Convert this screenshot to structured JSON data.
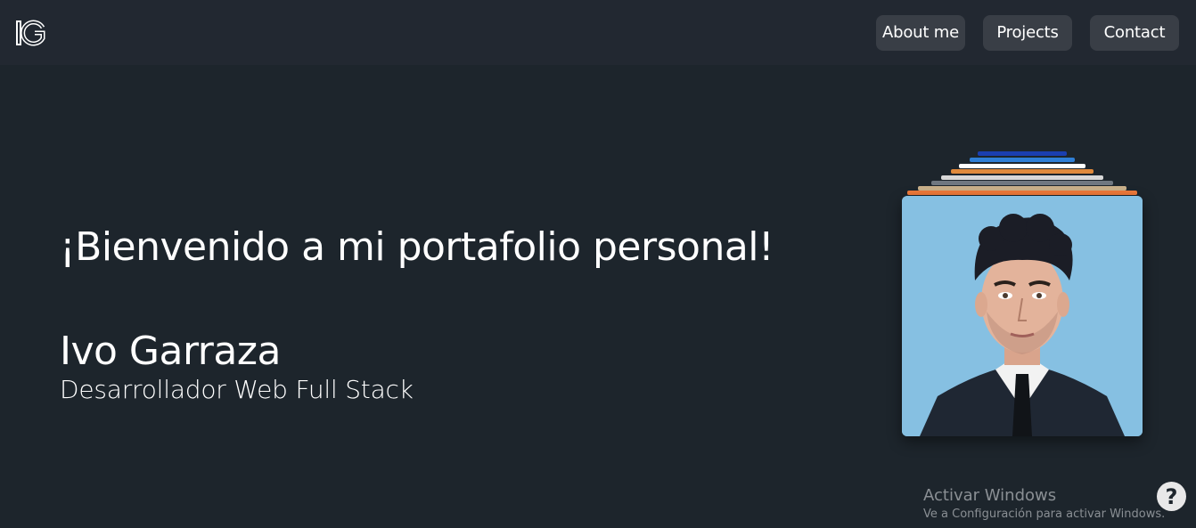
{
  "brand": {
    "logo_text": "IG"
  },
  "nav": {
    "about_label": "About me",
    "projects_label": "Projects",
    "contact_label": "Contact"
  },
  "hero": {
    "title": "¡Bienvenido a mi portafolio personal!",
    "name": "Ivo Garraza",
    "role": "Desarrollador Web Full Stack"
  },
  "profile": {
    "photo_icon": "profile-photo",
    "background_color": "#86c0e2"
  },
  "windows_watermark": {
    "title": "Activar Windows",
    "subtitle": "Ve a Configuración para activar Windows."
  },
  "help": {
    "label": "?"
  },
  "colors": {
    "page_bg": "#1d252c",
    "navbar_bg": "#222831",
    "button_bg": "#393e46",
    "text": "#ffffff"
  }
}
